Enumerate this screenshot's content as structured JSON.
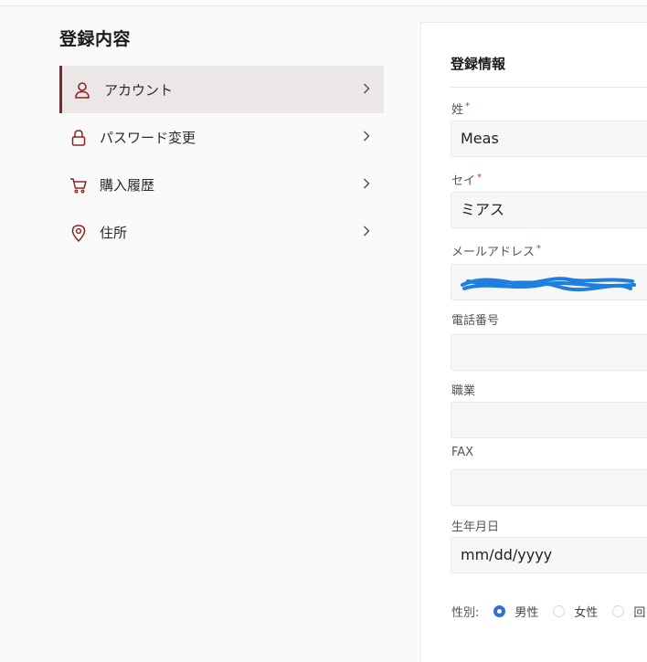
{
  "sidebar": {
    "title": "登録内容",
    "items": [
      {
        "label": "アカウント",
        "icon": "user-icon",
        "active": true
      },
      {
        "label": "パスワード変更",
        "icon": "lock-icon",
        "active": false
      },
      {
        "label": "購入履歴",
        "icon": "cart-icon",
        "active": false
      },
      {
        "label": "住所",
        "icon": "location-pin-icon",
        "active": false
      }
    ]
  },
  "form": {
    "title": "登録情報",
    "fields": {
      "last_name": {
        "label": "姓",
        "required": "*",
        "value": "Meas"
      },
      "last_name_kana": {
        "label": "セイ",
        "required": "*",
        "value": "ミアス"
      },
      "email": {
        "label": "メールアドレス",
        "required": "*",
        "value": ""
      },
      "phone": {
        "label": "電話番号",
        "value": ""
      },
      "occupation": {
        "label": "職業",
        "value": ""
      },
      "fax": {
        "label": "FAX",
        "value": ""
      },
      "birthdate": {
        "label": "生年月日",
        "value": "mm/dd/yyyy"
      }
    },
    "gender": {
      "label": "性別:",
      "options": [
        "男性",
        "女性",
        "回"
      ],
      "selected": "男性"
    }
  },
  "colors": {
    "accent": "#8a2424",
    "required": "#c0392b",
    "radio_selected": "#2f6fd6",
    "redaction": "#1e7fe0"
  }
}
